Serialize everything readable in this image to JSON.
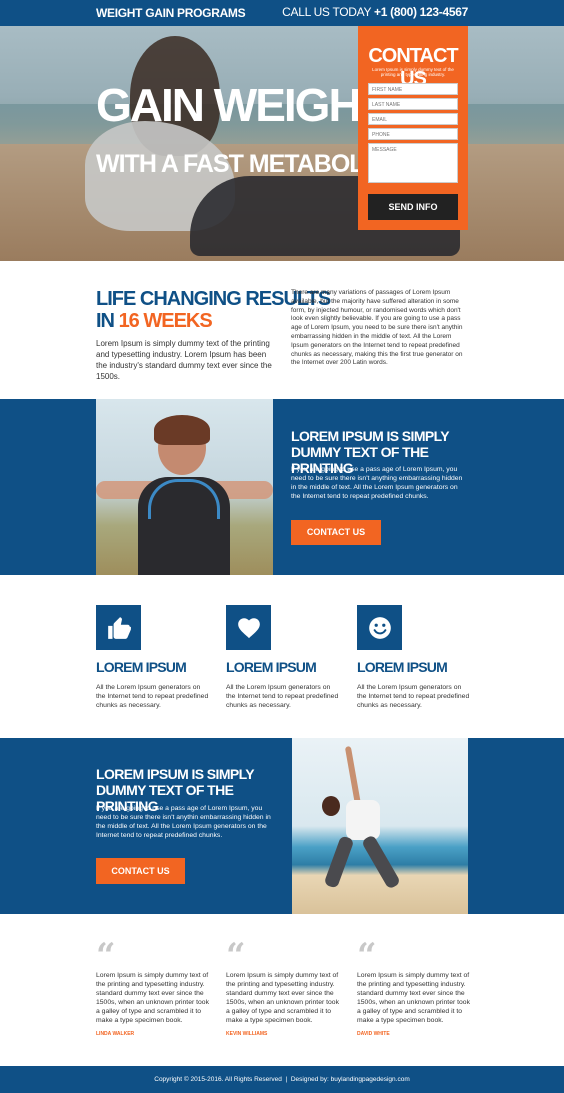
{
  "header": {
    "brand": "WEIGHT GAIN PROGRAMS",
    "call_label": "CALL US TODAY",
    "phone": "+1 (800) 123-4567"
  },
  "hero": {
    "title_line1": "GAIN WEIGHT",
    "title_line2": "WITH A FAST METABOLISM"
  },
  "form": {
    "title": "CONTACT US",
    "subtitle": "Lorem Ipsum is simply dummy text of the printing and typesetting industry.",
    "fields": {
      "first_name": "FIRST NAME",
      "last_name": "LAST NAME",
      "email": "EMAIL",
      "phone": "PHONE",
      "message": "MESSAGE"
    },
    "submit": "SEND INFO"
  },
  "results": {
    "title_line1": "LIFE CHANGING RESULTS",
    "title_in": "IN",
    "title_highlight": "16 WEEKS",
    "text": "Lorem Ipsum is simply dummy text of the printing and typesetting industry. Lorem Ipsum has been the industry's standard dummy text ever since the 1500s.",
    "side_text": "There are many variations of passages of Lorem Ipsum available, but the majority have suffered alteration in some form, by injected humour, or randomised words which don't look even slightly believable. If you are going to use a pass age of Lorem Ipsum, you need to be sure there isn't anythin embarrassing hidden in the middle of text. All the Lorem Ipsum generators on the Internet tend to repeat predefined chunks as necessary, making this the first true generator on the Internet over 200 Latin words."
  },
  "band1": {
    "title": "LOREM IPSUM IS SIMPLY DUMMY TEXT OF THE PRINTING",
    "text": "If you are going to use a pass age of Lorem Ipsum, you need to be sure there isn't anything embarrassing hidden in the middle of text. All the Lorem Ipsum generators on the Internet tend to repeat predefined chunks.",
    "button": "CONTACT US"
  },
  "features": [
    {
      "icon": "thumbs-up-icon",
      "title": "LOREM IPSUM",
      "text": "All the Lorem Ipsum generators on the Internet tend to repeat predefined chunks as necessary."
    },
    {
      "icon": "heart-icon",
      "title": "LOREM IPSUM",
      "text": "All the Lorem Ipsum generators on the Internet tend to repeat predefined chunks as necessary."
    },
    {
      "icon": "smiley-icon",
      "title": "LOREM IPSUM",
      "text": "All the Lorem Ipsum generators on the Internet tend to repeat predefined chunks as necessary."
    }
  ],
  "band2": {
    "title": "LOREM IPSUM IS SIMPLY DUMMY TEXT OF THE PRINTING",
    "text": "If you are going to use a pass age of Lorem Ipsum, you need to be sure there isn't anythin embarrassing hidden in the middle of text. All the Lorem Ipsum generators on the Internet tend to repeat predefined chunks.",
    "button": "CONTACT US"
  },
  "testimonials": [
    {
      "quote_mark": "“",
      "text": "Lorem Ipsum is simply dummy text of the printing and typesetting industry. standard dummy text ever since the 1500s, when an unknown printer took a galley of type and scrambled it to make a type specimen book.",
      "name": "LINDA WALKER"
    },
    {
      "quote_mark": "“",
      "text": "Lorem Ipsum is simply dummy text of the printing and typesetting industry. standard dummy text ever since the 1500s, when an unknown printer took a galley of type and scrambled it to make a type specimen book.",
      "name": "KEVIN WILLIAMS"
    },
    {
      "quote_mark": "“",
      "text": "Lorem Ipsum is simply dummy text of the printing and typesetting industry. standard dummy text ever since the 1500s, when an unknown printer took a galley of type and scrambled it to make a type specimen book.",
      "name": "DAVID WHITE"
    }
  ],
  "footer": {
    "copyright": "Copyright © 2015-2016. All Rights Reserved",
    "separator": "|",
    "designed_by": "Designed by: buylandingpagedesign.com"
  },
  "colors": {
    "primary_blue": "#0f5086",
    "accent_orange": "#f26522"
  }
}
